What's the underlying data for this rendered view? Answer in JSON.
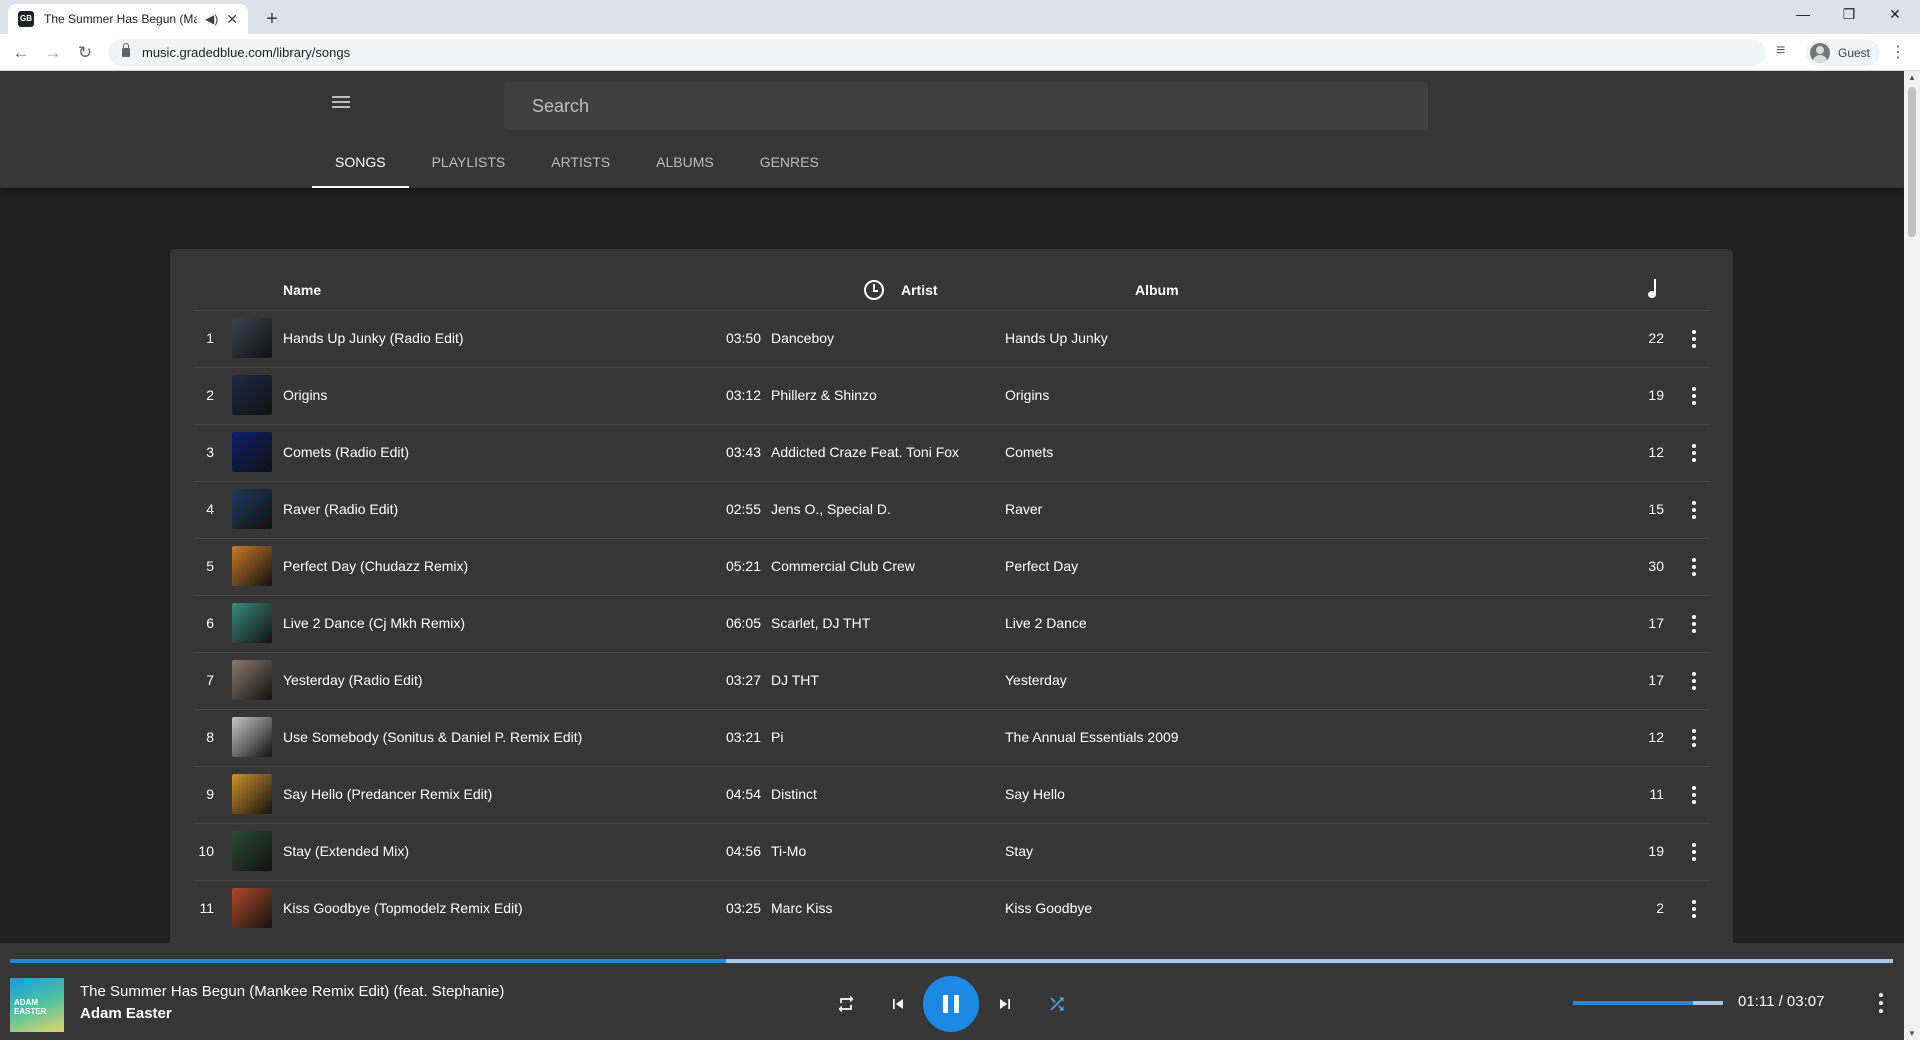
{
  "browser": {
    "tab_title": "The Summer Has Begun (Ma",
    "url": "music.gradedblue.com/library/songs",
    "profile_name": "Guest"
  },
  "header": {
    "search_placeholder": "Search",
    "tabs": [
      {
        "label": "SONGS",
        "active": true
      },
      {
        "label": "PLAYLISTS",
        "active": false
      },
      {
        "label": "ARTISTS",
        "active": false
      },
      {
        "label": "ALBUMS",
        "active": false
      },
      {
        "label": "GENRES",
        "active": false
      }
    ]
  },
  "table": {
    "columns": {
      "name": "Name",
      "artist": "Artist",
      "album": "Album"
    },
    "rows": [
      {
        "num": "1",
        "name": "Hands Up Junky (Radio Edit)",
        "duration": "03:50",
        "artist": "Danceboy",
        "album": "Hands Up Junky",
        "plays": "22",
        "art": "#3a4250"
      },
      {
        "num": "2",
        "name": "Origins",
        "duration": "03:12",
        "artist": "Phillerz & Shinzo",
        "album": "Origins",
        "plays": "19",
        "art": "#1c2a44"
      },
      {
        "num": "3",
        "name": "Comets (Radio Edit)",
        "duration": "03:43",
        "artist": "Addicted Craze Feat. Toni Fox",
        "album": "Comets",
        "plays": "12",
        "art": "#0d1f6b"
      },
      {
        "num": "4",
        "name": "Raver (Radio Edit)",
        "duration": "02:55",
        "artist": "Jens O., Special D.",
        "album": "Raver",
        "plays": "15",
        "art": "#1e3a5a"
      },
      {
        "num": "5",
        "name": "Perfect Day (Chudazz Remix)",
        "duration": "05:21",
        "artist": "Commercial Club Crew",
        "album": "Perfect Day",
        "plays": "30",
        "art": "#c97a2a"
      },
      {
        "num": "6",
        "name": "Live 2 Dance (Cj Mkh Remix)",
        "duration": "06:05",
        "artist": "Scarlet, DJ THT",
        "album": "Live 2 Dance",
        "plays": "17",
        "art": "#3b8a7a"
      },
      {
        "num": "7",
        "name": "Yesterday (Radio Edit)",
        "duration": "03:27",
        "artist": "DJ THT",
        "album": "Yesterday",
        "plays": "17",
        "art": "#8a7a6a"
      },
      {
        "num": "8",
        "name": "Use Somebody (Sonitus & Daniel P. Remix Edit)",
        "duration": "03:21",
        "artist": "Pi",
        "album": "The Annual Essentials 2009",
        "plays": "12",
        "art": "#c8c8c8"
      },
      {
        "num": "9",
        "name": "Say Hello (Predancer Remix Edit)",
        "duration": "04:54",
        "artist": "Distinct",
        "album": "Say Hello",
        "plays": "11",
        "art": "#d0902a"
      },
      {
        "num": "10",
        "name": "Stay (Extended Mix)",
        "duration": "04:56",
        "artist": "Ti-Mo",
        "album": "Stay",
        "plays": "19",
        "art": "#2a4a3a"
      },
      {
        "num": "11",
        "name": "Kiss Goodbye (Topmodelz Remix Edit)",
        "duration": "03:25",
        "artist": "Marc Kiss",
        "album": "Kiss Goodbye",
        "plays": "2",
        "art": "#b04a2a"
      }
    ]
  },
  "player": {
    "title": "The Summer Has Begun (Mankee Remix Edit) (feat. Stephanie)",
    "artist": "Adam Easter",
    "art_text": "ADAM EASTER",
    "time": "01:11 / 03:07",
    "progress": 0.38,
    "volume": 0.8,
    "accent": "#1e88e5"
  }
}
